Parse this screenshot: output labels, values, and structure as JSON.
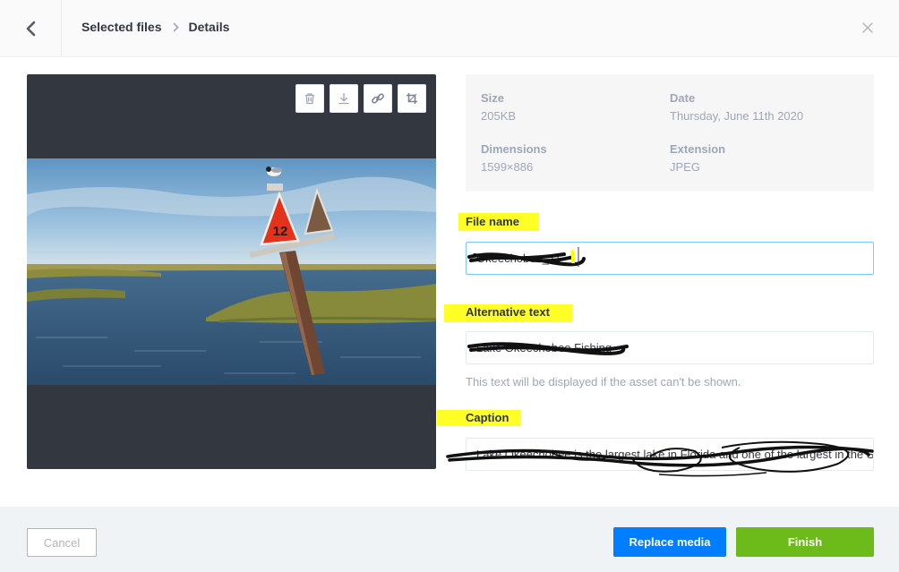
{
  "header": {
    "breadcrumb": [
      "Selected files",
      "Details"
    ]
  },
  "toolbar": {
    "icons": [
      "trash-icon",
      "download-icon",
      "link-icon",
      "crop-icon"
    ]
  },
  "info": {
    "size_label": "Size",
    "size_value": "205KB",
    "date_label": "Date",
    "date_value": "Thursday, June 11th 2020",
    "dimensions_label": "Dimensions",
    "dimensions_value": "1599×886",
    "extension_label": "Extension",
    "extension_value": "JPEG"
  },
  "form": {
    "file_name_label": "File name",
    "file_name_value": "Okeechobee_11",
    "alt_text_label": "Alternative text",
    "alt_text_value": "Lake Okeechobee Fishing",
    "alt_text_hint": "This text will be displayed if the asset can't be shown.",
    "caption_label": "Caption",
    "caption_value": "Lake Okeechobee is the largest lake in Florida and one of the largest in the South"
  },
  "footer": {
    "cancel_label": "Cancel",
    "replace_label": "Replace media",
    "finish_label": "Finish"
  },
  "colors": {
    "primary": "#007eff",
    "success": "#6dbb1a",
    "preview_bg": "#333740",
    "highlight": "#ffff00"
  }
}
